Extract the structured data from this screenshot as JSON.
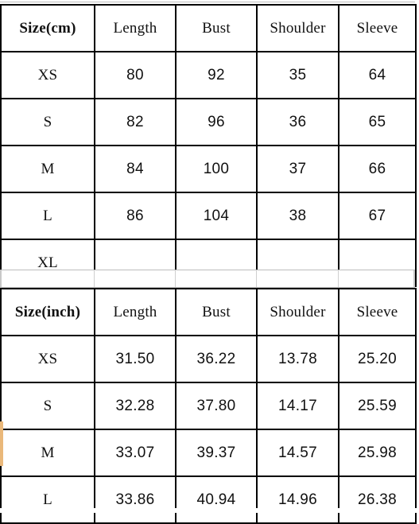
{
  "tables": [
    {
      "id": "cm",
      "unit_label": "Size(cm)",
      "columns": [
        "Size(cm)",
        "Length",
        "Bust",
        "Shoulder",
        "Sleeve"
      ],
      "rows": [
        {
          "size": "XS",
          "length": "80",
          "bust": "92",
          "shoulder": "35",
          "sleeve": "64"
        },
        {
          "size": "S",
          "length": "82",
          "bust": "96",
          "shoulder": "36",
          "sleeve": "65"
        },
        {
          "size": "M",
          "length": "84",
          "bust": "100",
          "shoulder": "37",
          "sleeve": "66"
        },
        {
          "size": "L",
          "length": "86",
          "bust": "104",
          "shoulder": "38",
          "sleeve": "67"
        },
        {
          "size": "XL",
          "length": "",
          "bust": "",
          "shoulder": "",
          "sleeve": ""
        }
      ]
    },
    {
      "id": "inch",
      "unit_label": "Size(inch)",
      "columns": [
        "Size(inch)",
        "Length",
        "Bust",
        "Shoulder",
        "Sleeve"
      ],
      "rows": [
        {
          "size": "XS",
          "length": "31.50",
          "bust": "36.22",
          "shoulder": "13.78",
          "sleeve": "25.20"
        },
        {
          "size": "S",
          "length": "32.28",
          "bust": "37.80",
          "shoulder": "14.17",
          "sleeve": "25.59"
        },
        {
          "size": "M",
          "length": "33.07",
          "bust": "39.37",
          "shoulder": "14.57",
          "sleeve": "25.98"
        },
        {
          "size": "L",
          "length": "33.86",
          "bust": "40.94",
          "shoulder": "14.96",
          "sleeve": "26.38"
        }
      ]
    }
  ],
  "colors": {
    "header_blue": "#93c5fd",
    "grid_black": "#000000",
    "grid_light": "#cfcfcf",
    "row_marker_orange": "#eab87a",
    "text": "#111111",
    "background": "#ffffff"
  }
}
